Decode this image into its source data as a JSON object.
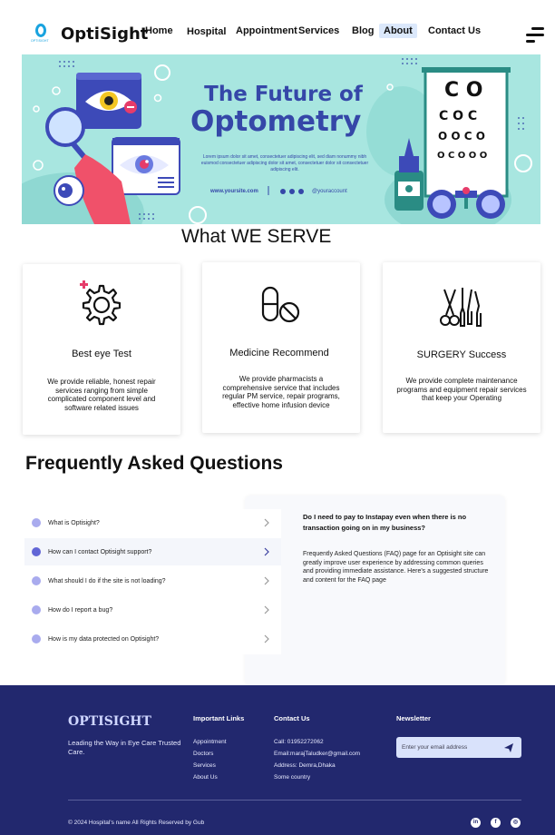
{
  "nav": {
    "logo_text": "OptiSight",
    "logo_sub": "OPTISIGHT",
    "items": [
      "Home",
      "Hospital",
      "Appointment",
      "Services",
      "Blog",
      "About",
      "Contact Us"
    ],
    "active": "About",
    "menu_icon": "hamburger-icon"
  },
  "hero": {
    "title_line1": "The Future of",
    "title_line2": "Optometry",
    "lorem": "Lorem ipsum dolor sit amet, consectetuer adipiscing elit, sed diam nonummy nibh euismod consectetuer adipiscing dolor sit amet, consectetuer dolor sit consectetuer adipiscing elit.",
    "website": "www.yoursite.com",
    "account": "@youraccount",
    "colors": {
      "bg": "#a8e6e0",
      "title": "#3547a8",
      "accent": "#e63c6a"
    }
  },
  "serve": {
    "title": "What WE SERVE",
    "cards": [
      {
        "icon": "gear-plus-icon",
        "title": "Best eye Test",
        "desc": "We provide reliable, honest repair services ranging from simple complicated component level and software related issues"
      },
      {
        "icon": "pills-icon",
        "title": "Medicine Recommend",
        "desc": "We provide pharmacists a comprehensive service that includes regular PM service, repair programs, effective home infusion device"
      },
      {
        "icon": "surgical-tools-icon",
        "title": "SURGERY Success",
        "desc": "We provide complete maintenance programs and equipment repair services that keep your Operating"
      }
    ]
  },
  "faq": {
    "title": "Frequently Asked Questions",
    "questions": [
      "What is Optisight?",
      "How can I contact Optisight support?",
      "What should I do if the site is not loading?",
      "How do I report a bug?",
      "How is my data protected on Optisight?"
    ],
    "active_index": 1,
    "answer_question": "Do I need to pay to Instapay even when there is no transaction going on in my business?",
    "answer_text": "Frequently Asked Questions (FAQ) page for an Optisight site can greatly improve user experience by addressing common queries and providing immediate assistance. Here's a suggested structure and content for the FAQ page"
  },
  "footer": {
    "brand": "OPTISIGHT",
    "tagline": "Leading the Way in Eye Care Trusted Care.",
    "links_heading": "Important Links",
    "links": [
      "Appointment",
      "Doctors",
      "Services",
      "About Us"
    ],
    "contact_heading": "Contact Us",
    "contact": [
      "Call: 01952272062",
      "Email:marajTaludker@gmail.com",
      "Address: Demra,Dhaka",
      "Some country"
    ],
    "newsletter_heading": "Newsletter",
    "newsletter_placeholder": "Enter your email address",
    "copyright": "© 2024 Hospital's name All Rights Reserved by Gub",
    "social": [
      {
        "icon": "linkedin-icon",
        "glyph": "in"
      },
      {
        "icon": "facebook-icon",
        "glyph": "f"
      },
      {
        "icon": "instagram-icon",
        "glyph": "◎"
      }
    ],
    "colors": {
      "bg": "#22286e"
    }
  }
}
